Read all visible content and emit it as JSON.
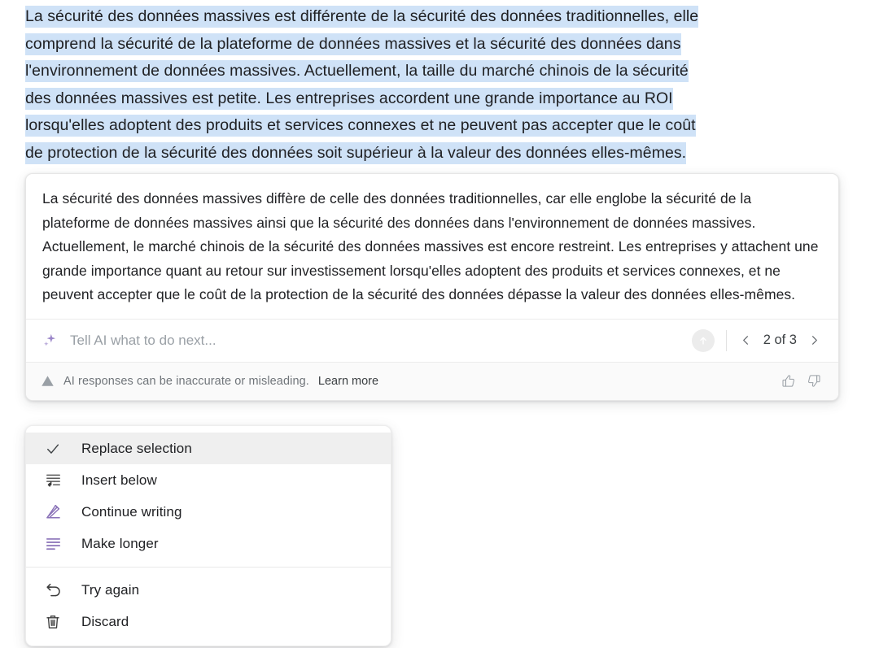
{
  "document": {
    "selected_text_lines": [
      "La sécurité des données massives est différente de la sécurité des données traditionnelles, elle",
      "comprend la sécurité de la plateforme de données massives et la sécurité des données dans",
      "l'environnement de données massives. Actuellement, la taille du marché chinois de la sécurité",
      "des données massives est petite. Les entreprises accordent une grande importance au ROI",
      "lorsqu'elles adoptent des produits et services connexes et ne peuvent pas accepter que le coût",
      "de protection de la sécurité des données soit supérieur à la valeur des données elles-mêmes."
    ],
    "selection_highlight_color": "#cfe2f7"
  },
  "ai_card": {
    "response_text": "La sécurité des données massives diffère de celle des données traditionnelles, car elle englobe la sécurité de la plateforme de données massives ainsi que la sécurité des données dans l'environnement de données massives. Actuellement, le marché chinois de la sécurité des données massives est encore restreint. Les entreprises y attachent une grande importance quant au retour sur investissement lorsqu'elles adoptent des produits et services connexes, et ne peuvent accepter que le coût de la protection de la sécurité des données dépasse la valeur des données elles-mêmes.",
    "prompt": {
      "icon": "sparkle-icon",
      "placeholder": "Tell AI what to do next...",
      "value": "",
      "send_icon": "arrow-up-circle-icon"
    },
    "pager": {
      "prev_icon": "chevron-left-icon",
      "label": "2 of 3",
      "next_icon": "chevron-right-icon",
      "current": 2,
      "total": 3
    },
    "footer": {
      "warning_icon": "warning-triangle-icon",
      "disclaimer": "AI responses can be inaccurate or misleading.",
      "learn_more": "Learn more",
      "thumbs_up_icon": "thumbs-up-icon",
      "thumbs_down_icon": "thumbs-down-icon"
    }
  },
  "menu": {
    "items": [
      {
        "label": "Replace selection",
        "icon": "check-icon",
        "selected": true
      },
      {
        "label": "Insert below",
        "icon": "insert-below-icon",
        "selected": false
      },
      {
        "label": "Continue writing",
        "icon": "pencil-icon",
        "selected": false
      },
      {
        "label": "Make longer",
        "icon": "text-lines-icon",
        "selected": false
      },
      {
        "label": "Try again",
        "icon": "undo-arrow-icon",
        "selected": false
      },
      {
        "label": "Discard",
        "icon": "trash-icon",
        "selected": false
      }
    ],
    "accent_color": "#8a72b8"
  }
}
